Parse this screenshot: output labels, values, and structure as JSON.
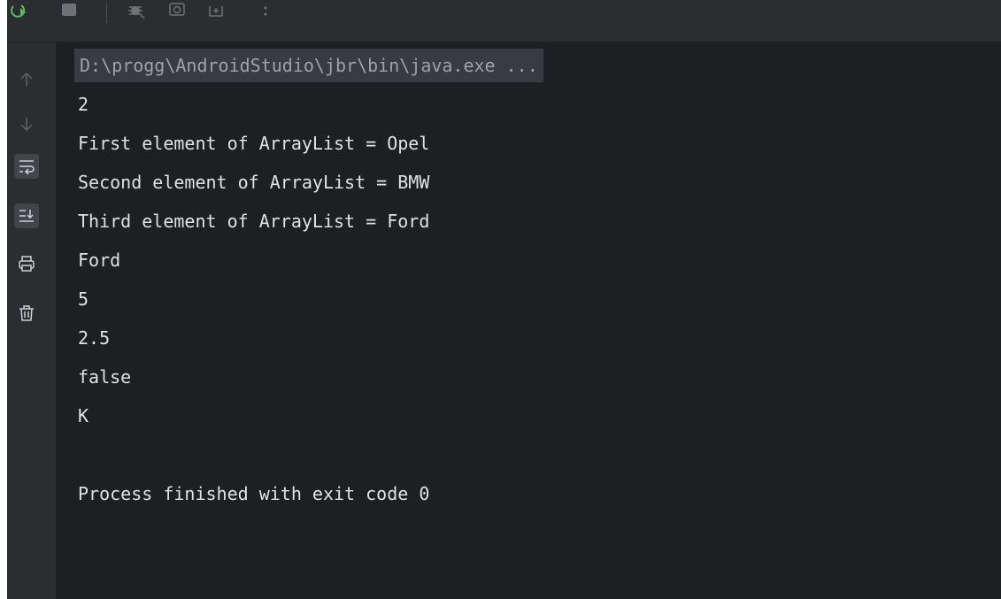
{
  "toolbar": {
    "icons": [
      "rerun-icon",
      "stop-icon",
      "debug-icon",
      "camera-icon",
      "restore-layout-icon",
      "more-options-icon"
    ]
  },
  "gutter": {
    "buttons": [
      "up-arrow-icon",
      "down-arrow-icon",
      "soft-wrap-icon",
      "scroll-to-end-icon",
      "print-icon",
      "clear-all-icon"
    ]
  },
  "console": {
    "command": "D:\\progg\\AndroidStudio\\jbr\\bin\\java.exe ...",
    "lines": [
      "2",
      "First element of ArrayList = Opel",
      "Second element of ArrayList = BMW",
      "Third element of ArrayList = Ford",
      "Ford",
      "5",
      "2.5",
      "false",
      "K",
      "",
      "Process finished with exit code 0"
    ]
  },
  "colors": {
    "console_bg": "#1e1f22",
    "panel_bg": "#2b2d30",
    "text": "#dfe1e5",
    "command_bg": "#393b40",
    "command_text": "#9ea1a6",
    "rerun_green": "#5fb865"
  }
}
